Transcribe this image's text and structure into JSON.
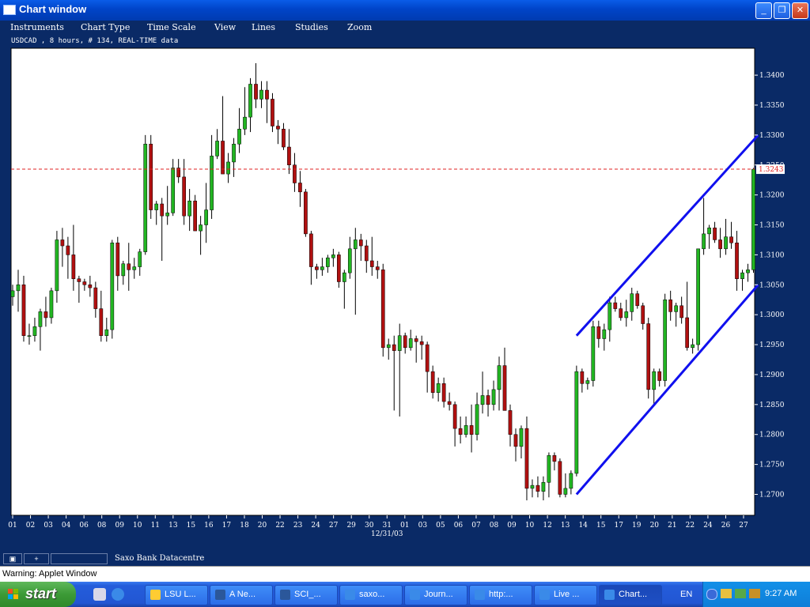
{
  "window": {
    "title": "Chart window",
    "controls": {
      "minimize": "_",
      "maximize": "❐",
      "close": "✕"
    }
  },
  "menu": [
    "Instruments",
    "Chart Type",
    "Time Scale",
    "View",
    "Lines",
    "Studies",
    "Zoom"
  ],
  "info_line": "USDCAD , 8 hours, # 134, REAL-TIME data",
  "statusbar": {
    "text": "Saxo Bank Datacentre",
    "btn1": "▣",
    "btn2": "+"
  },
  "warning": "Warning: Applet Window",
  "taskbar": {
    "start": "start",
    "buttons": [
      "LSU L...",
      "A Ne...",
      "SCI_...",
      "saxo...",
      "Journ...",
      "http:...",
      "Live ...",
      "Chart..."
    ],
    "active_index": 7,
    "lang": "EN",
    "clock": "9:27 AM"
  },
  "colors": {
    "up": "#22b522",
    "down": "#b01010",
    "trendline": "#1010ee",
    "price_line": "#e02020",
    "price_label": "#e02020"
  },
  "chart_data": {
    "type": "candlestick",
    "instrument": "USDCAD",
    "timeframe": "8 hours",
    "ylim": [
      1.2665,
      1.3445
    ],
    "yticks": [
      "1.3400",
      "1.3350",
      "1.3300",
      "1.3250",
      "1.3200",
      "1.3150",
      "1.3100",
      "1.3050",
      "1.3000",
      "1.2950",
      "1.2900",
      "1.2850",
      "1.2800",
      "1.2750",
      "1.2700"
    ],
    "xticks": [
      "01",
      "02",
      "03",
      "04",
      "06",
      "08",
      "09",
      "10",
      "11",
      "13",
      "15",
      "16",
      "17",
      "18",
      "20",
      "22",
      "23",
      "24",
      "27",
      "29",
      "30",
      "31",
      "01",
      "03",
      "05",
      "06",
      "07",
      "08",
      "09",
      "10",
      "12",
      "13",
      "14",
      "15",
      "17",
      "19",
      "20",
      "21",
      "22",
      "24",
      "26",
      "27"
    ],
    "date_label": {
      "text": "12/31/03",
      "at_tick": "31"
    },
    "current_price": {
      "value": 1.3243,
      "label": "1.3243"
    },
    "trendlines": [
      {
        "name": "upper channel",
        "from": [
          102,
          1.2965
        ],
        "to": [
          134,
          1.33
        ]
      },
      {
        "name": "lower channel",
        "from": [
          102,
          1.27
        ],
        "to": [
          134,
          1.305
        ]
      }
    ],
    "ohlc": [
      [
        1.303,
        1.305,
        1.3015,
        1.304
      ],
      [
        1.304,
        1.3075,
        1.3005,
        1.305
      ],
      [
        1.305,
        1.3065,
        1.2955,
        1.2965
      ],
      [
        1.2965,
        1.2985,
        1.295,
        1.2965
      ],
      [
        1.2965,
        1.2995,
        1.2955,
        1.298
      ],
      [
        1.298,
        1.301,
        1.294,
        1.3005
      ],
      [
        1.3005,
        1.303,
        1.298,
        1.2995
      ],
      [
        1.2995,
        1.3045,
        1.2985,
        1.304
      ],
      [
        1.304,
        1.314,
        1.302,
        1.3125
      ],
      [
        1.3125,
        1.3145,
        1.308,
        1.3115
      ],
      [
        1.3115,
        1.313,
        1.306,
        1.31
      ],
      [
        1.31,
        1.315,
        1.304,
        1.306
      ],
      [
        1.306,
        1.3065,
        1.302,
        1.3055
      ],
      [
        1.3055,
        1.306,
        1.304,
        1.305
      ],
      [
        1.305,
        1.3065,
        1.303,
        1.3045
      ],
      [
        1.3045,
        1.3055,
        1.2995,
        1.301
      ],
      [
        1.301,
        1.304,
        1.2955,
        1.2965
      ],
      [
        1.2965,
        1.2995,
        1.2955,
        1.2975
      ],
      [
        1.2975,
        1.3125,
        1.296,
        1.312
      ],
      [
        1.312,
        1.313,
        1.304,
        1.3065
      ],
      [
        1.3065,
        1.309,
        1.305,
        1.3085
      ],
      [
        1.3085,
        1.312,
        1.304,
        1.3075
      ],
      [
        1.3075,
        1.3095,
        1.306,
        1.308
      ],
      [
        1.308,
        1.311,
        1.3065,
        1.3105
      ],
      [
        1.3105,
        1.33,
        1.31,
        1.3285
      ],
      [
        1.3285,
        1.33,
        1.316,
        1.3175
      ],
      [
        1.3175,
        1.319,
        1.315,
        1.3185
      ],
      [
        1.3185,
        1.3195,
        1.309,
        1.3165
      ],
      [
        1.3165,
        1.3215,
        1.315,
        1.317
      ],
      [
        1.317,
        1.326,
        1.3165,
        1.3245
      ],
      [
        1.3245,
        1.326,
        1.322,
        1.323
      ],
      [
        1.323,
        1.326,
        1.315,
        1.3165
      ],
      [
        1.3165,
        1.321,
        1.314,
        1.319
      ],
      [
        1.319,
        1.32,
        1.314,
        1.314
      ],
      [
        1.314,
        1.3165,
        1.31,
        1.315
      ],
      [
        1.315,
        1.322,
        1.312,
        1.3175
      ],
      [
        1.3175,
        1.33,
        1.316,
        1.3265
      ],
      [
        1.3265,
        1.331,
        1.326,
        1.329
      ],
      [
        1.329,
        1.3365,
        1.3255,
        1.3235
      ],
      [
        1.3235,
        1.327,
        1.322,
        1.3255
      ],
      [
        1.3255,
        1.3295,
        1.323,
        1.3285
      ],
      [
        1.3285,
        1.3345,
        1.327,
        1.331
      ],
      [
        1.331,
        1.338,
        1.33,
        1.333
      ],
      [
        1.333,
        1.3395,
        1.3305,
        1.3385
      ],
      [
        1.3385,
        1.342,
        1.3345,
        1.336
      ],
      [
        1.336,
        1.339,
        1.3345,
        1.3375
      ],
      [
        1.3375,
        1.339,
        1.332,
        1.336
      ],
      [
        1.336,
        1.337,
        1.3305,
        1.3315
      ],
      [
        1.3315,
        1.3325,
        1.3285,
        1.331
      ],
      [
        1.331,
        1.332,
        1.3275,
        1.328
      ],
      [
        1.328,
        1.331,
        1.3235,
        1.325
      ],
      [
        1.325,
        1.327,
        1.3205,
        1.322
      ],
      [
        1.322,
        1.324,
        1.318,
        1.3205
      ],
      [
        1.3205,
        1.321,
        1.313,
        1.3135
      ],
      [
        1.3135,
        1.314,
        1.305,
        1.308
      ],
      [
        1.308,
        1.3085,
        1.306,
        1.3075
      ],
      [
        1.3075,
        1.3095,
        1.3065,
        1.308
      ],
      [
        1.308,
        1.31,
        1.307,
        1.3095
      ],
      [
        1.3095,
        1.311,
        1.308,
        1.31
      ],
      [
        1.31,
        1.3105,
        1.3045,
        1.3055
      ],
      [
        1.3055,
        1.3075,
        1.301,
        1.307
      ],
      [
        1.307,
        1.313,
        1.306,
        1.311
      ],
      [
        1.311,
        1.3145,
        1.3,
        1.3125
      ],
      [
        1.3125,
        1.3135,
        1.309,
        1.3115
      ],
      [
        1.3115,
        1.3125,
        1.307,
        1.309
      ],
      [
        1.309,
        1.313,
        1.3065,
        1.308
      ],
      [
        1.308,
        1.309,
        1.306,
        1.3075
      ],
      [
        1.3075,
        1.3085,
        1.293,
        1.2945
      ],
      [
        1.2945,
        1.296,
        1.2925,
        1.295
      ],
      [
        1.295,
        1.2965,
        1.284,
        1.294
      ],
      [
        1.294,
        1.2985,
        1.283,
        1.2965
      ],
      [
        1.2965,
        1.297,
        1.2935,
        1.2945
      ],
      [
        1.2945,
        1.2975,
        1.294,
        1.296
      ],
      [
        1.296,
        1.2965,
        1.292,
        1.2955
      ],
      [
        1.2955,
        1.2965,
        1.2925,
        1.295
      ],
      [
        1.295,
        1.2955,
        1.287,
        1.2905
      ],
      [
        1.2905,
        1.2915,
        1.286,
        1.287
      ],
      [
        1.287,
        1.2895,
        1.2855,
        1.2885
      ],
      [
        1.2885,
        1.2895,
        1.2845,
        1.2855
      ],
      [
        1.2855,
        1.287,
        1.284,
        1.285
      ],
      [
        1.285,
        1.2855,
        1.278,
        1.281
      ],
      [
        1.281,
        1.283,
        1.2785,
        1.28
      ],
      [
        1.28,
        1.283,
        1.2795,
        1.2815
      ],
      [
        1.2815,
        1.285,
        1.277,
        1.28
      ],
      [
        1.28,
        1.287,
        1.279,
        1.285
      ],
      [
        1.285,
        1.2905,
        1.2835,
        1.2865
      ],
      [
        1.2865,
        1.2875,
        1.283,
        1.285
      ],
      [
        1.285,
        1.289,
        1.284,
        1.2875
      ],
      [
        1.2875,
        1.293,
        1.284,
        1.2915
      ],
      [
        1.2915,
        1.2945,
        1.287,
        1.284
      ],
      [
        1.284,
        1.285,
        1.278,
        1.28
      ],
      [
        1.28,
        1.281,
        1.2755,
        1.278
      ],
      [
        1.278,
        1.2815,
        1.276,
        1.281
      ],
      [
        1.281,
        1.283,
        1.269,
        1.271
      ],
      [
        1.271,
        1.2725,
        1.2695,
        1.2715
      ],
      [
        1.2715,
        1.273,
        1.2695,
        1.2705
      ],
      [
        1.2705,
        1.273,
        1.269,
        1.272
      ],
      [
        1.272,
        1.277,
        1.2695,
        1.2765
      ],
      [
        1.2765,
        1.277,
        1.274,
        1.2755
      ],
      [
        1.2755,
        1.276,
        1.2695,
        1.27
      ],
      [
        1.27,
        1.2735,
        1.2695,
        1.271
      ],
      [
        1.271,
        1.274,
        1.27,
        1.2735
      ],
      [
        1.2735,
        1.2915,
        1.273,
        1.2905
      ],
      [
        1.2905,
        1.291,
        1.287,
        1.2885
      ],
      [
        1.2885,
        1.2895,
        1.2875,
        1.289
      ],
      [
        1.289,
        1.299,
        1.288,
        1.298
      ],
      [
        1.298,
        1.299,
        1.2945,
        1.296
      ],
      [
        1.296,
        1.2985,
        1.294,
        1.2975
      ],
      [
        1.2975,
        1.303,
        1.2955,
        1.302
      ],
      [
        1.302,
        1.303,
        1.3005,
        1.301
      ],
      [
        1.301,
        1.302,
        1.299,
        1.2995
      ],
      [
        1.2995,
        1.3025,
        1.298,
        1.3005
      ],
      [
        1.3005,
        1.3045,
        1.299,
        1.3035
      ],
      [
        1.3035,
        1.304,
        1.301,
        1.3015
      ],
      [
        1.3015,
        1.302,
        1.2975,
        1.2985
      ],
      [
        1.2985,
        1.2995,
        1.286,
        1.2875
      ],
      [
        1.2875,
        1.291,
        1.285,
        1.2905
      ],
      [
        1.2905,
        1.291,
        1.288,
        1.289
      ],
      [
        1.289,
        1.3035,
        1.288,
        1.3025
      ],
      [
        1.3025,
        1.304,
        1.299,
        1.3005
      ],
      [
        1.3005,
        1.302,
        1.298,
        1.3015
      ],
      [
        1.3015,
        1.303,
        1.2985,
        1.2995
      ],
      [
        1.2995,
        1.3055,
        1.294,
        1.2945
      ],
      [
        1.2945,
        1.296,
        1.2935,
        1.295
      ],
      [
        1.295,
        1.311,
        1.294,
        1.311
      ],
      [
        1.311,
        1.3195,
        1.31,
        1.3135
      ],
      [
        1.3135,
        1.315,
        1.311,
        1.3145
      ],
      [
        1.3145,
        1.3155,
        1.312,
        1.3125
      ],
      [
        1.3125,
        1.3145,
        1.3095,
        1.311
      ],
      [
        1.311,
        1.316,
        1.31,
        1.313
      ],
      [
        1.313,
        1.3155,
        1.311,
        1.312
      ],
      [
        1.312,
        1.314,
        1.304,
        1.306
      ],
      [
        1.306,
        1.3075,
        1.304,
        1.307
      ],
      [
        1.307,
        1.3085,
        1.3055,
        1.3075
      ],
      [
        1.3075,
        1.3245,
        1.307,
        1.3243
      ]
    ]
  }
}
